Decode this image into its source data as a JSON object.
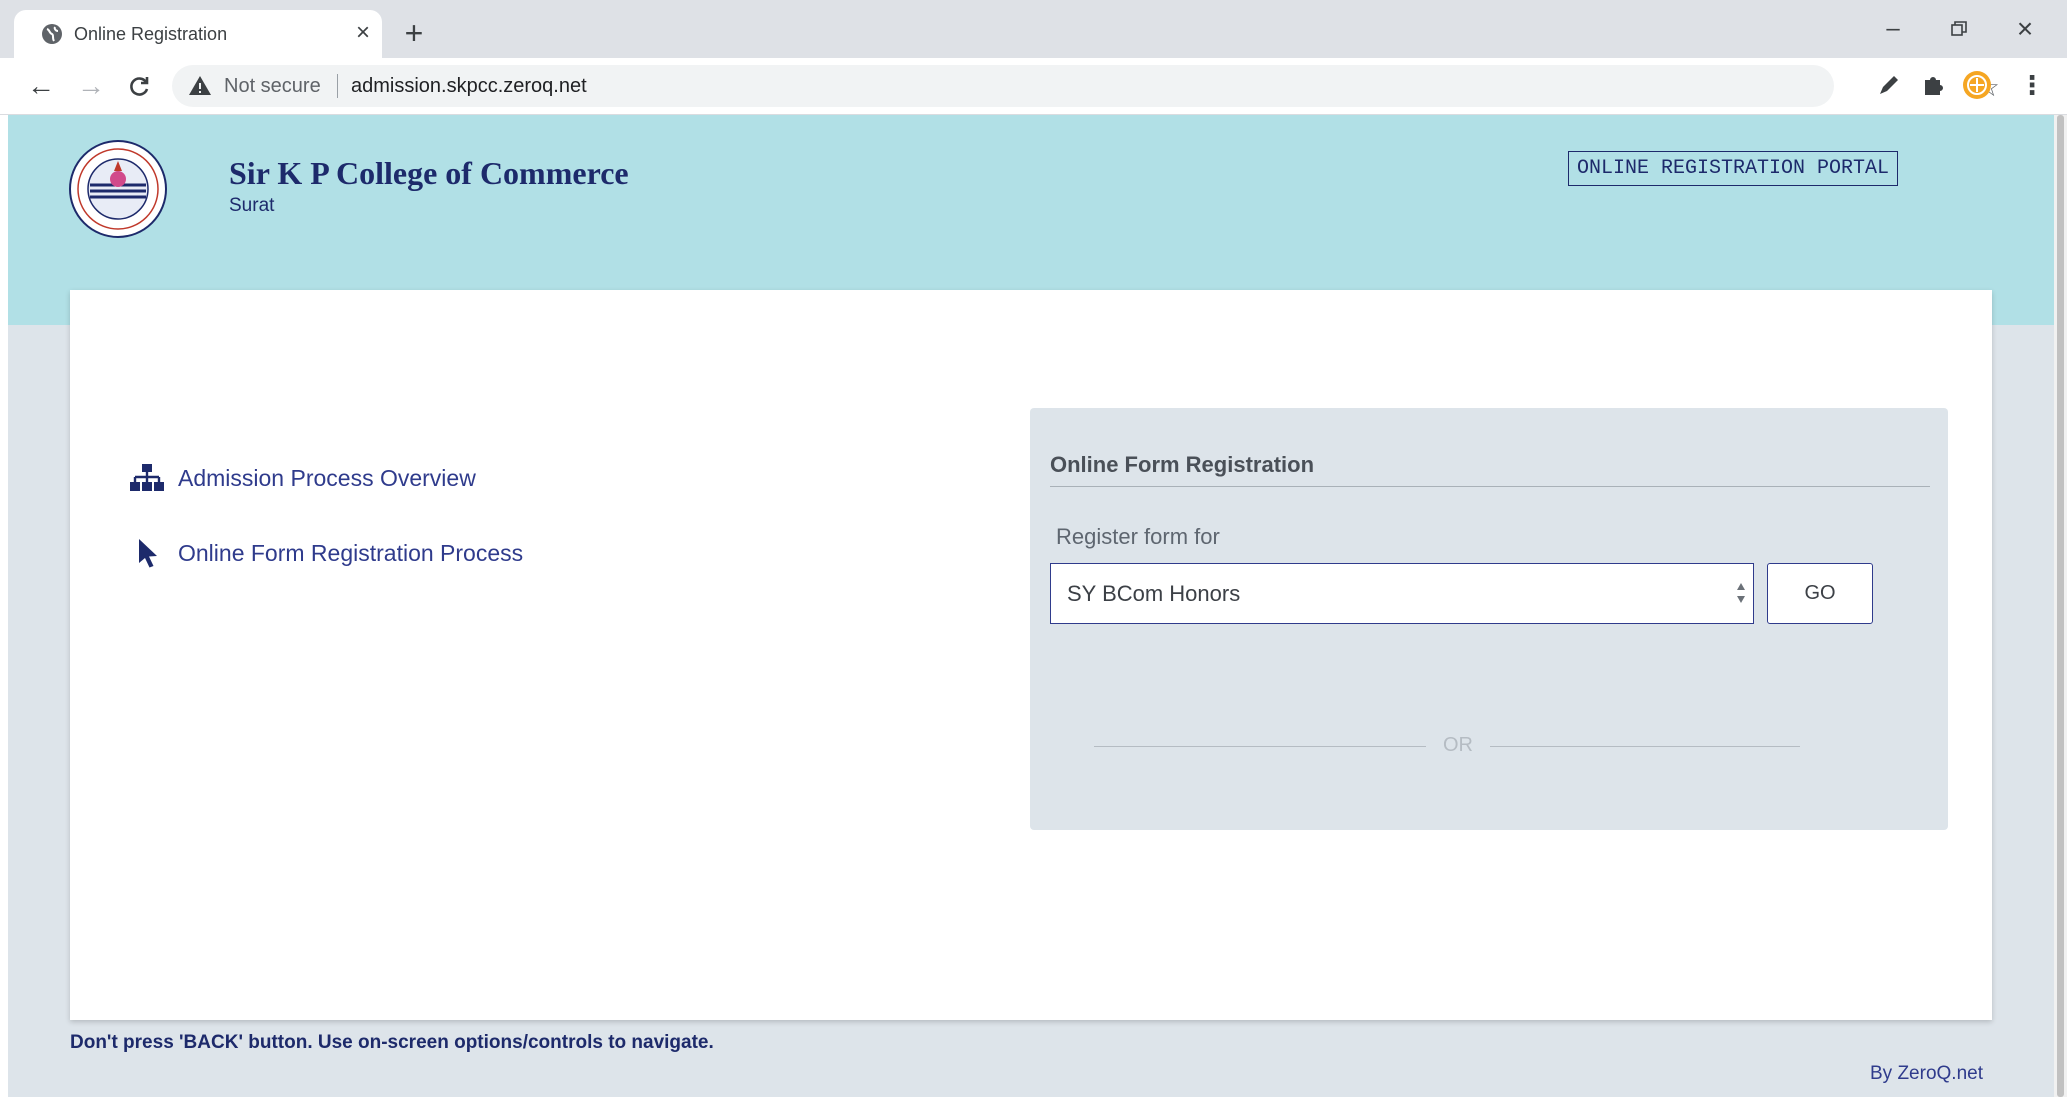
{
  "browser": {
    "tab_title": "Online Registration",
    "address_security": "Not secure",
    "address_url": "admission.skpcc.zeroq.net",
    "icons": [
      "globe-icon",
      "close-icon",
      "plus-icon",
      "back-icon",
      "forward-icon",
      "reload-icon",
      "warning-icon",
      "star-icon",
      "pen-icon",
      "puzzle-icon",
      "profile-icon",
      "menu-icon",
      "minimize-icon",
      "restore-icon",
      "window-close-icon"
    ]
  },
  "header": {
    "college_name": "Sir K P College of Commerce",
    "college_city": "Surat",
    "portal_label": "ONLINE REGISTRATION PORTAL"
  },
  "links": [
    {
      "label": "Admission Process Overview",
      "icon": "sitemap-icon"
    },
    {
      "label": "Online Form Registration Process",
      "icon": "pointer-icon"
    }
  ],
  "registration": {
    "title": "Online Form Registration",
    "register_label": "Register form for",
    "selected_option": "SY BCom Honors",
    "go_label": "GO",
    "separator": "OR"
  },
  "footer": {
    "warning": "Don't press 'BACK' button. Use on-screen options/controls to navigate.",
    "credit": "By ZeroQ.net"
  },
  "colors": {
    "header_band": "#b1e0e6",
    "page_background": "#dde4ea",
    "brand_navy": "#1d2a6b",
    "link_blue": "#2f3b8c"
  }
}
